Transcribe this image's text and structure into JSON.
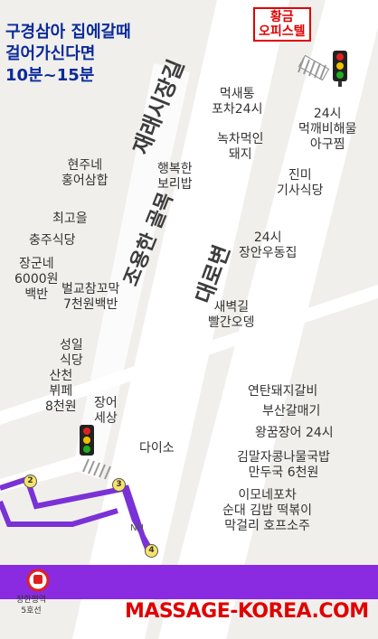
{
  "headline": {
    "line1": "구경삼아 집에갈때",
    "line2": "걸어가신다면",
    "line3": "10분~15분"
  },
  "badge": {
    "line1": "황금",
    "line2": "오피스텔"
  },
  "streets": {
    "jaeraesijang": "재래시장길",
    "joyonghan": "조용한 골목",
    "daerobeon": "대로변"
  },
  "places": [
    {
      "name": "먹새통\n포차24시"
    },
    {
      "name": "24시\n먹깨비해물\n아구찜"
    },
    {
      "name": "녹차먹인\n돼지"
    },
    {
      "name": "현주네\n홍어삼합"
    },
    {
      "name": "행복한\n보리밥"
    },
    {
      "name": "진미\n기사식당"
    },
    {
      "name": "최고을"
    },
    {
      "name": "충주식당"
    },
    {
      "name": "24시\n장안우동집"
    },
    {
      "name": "장군네\n6000원\n백반"
    },
    {
      "name": "벌교참꼬막\n7천원백반"
    },
    {
      "name": "새벽길\n빨간오뎅"
    },
    {
      "name": "성일\n식당"
    },
    {
      "name": "산천\n뷔페\n8천원"
    },
    {
      "name": "장어\n세상"
    },
    {
      "name": "연탄돼지갈비"
    },
    {
      "name": "부산갈매기"
    },
    {
      "name": "왕꿈장어 24시"
    },
    {
      "name": "다이소"
    },
    {
      "name": "김말자콩나물국밥\n만두국 6천원"
    },
    {
      "name": "이모네포차\n순대 김밥 떡볶이\n막걸리 호프소주"
    }
  ],
  "exits": [
    "2",
    "3",
    "4"
  ],
  "station": {
    "line1": "장한평역",
    "line2": "5호선"
  },
  "nh_label": "NH",
  "watermark": "MASSAGE-KOREA.COM",
  "colors": {
    "road": "#ffffff",
    "background": "#f0efec",
    "subway": "#8a2be2",
    "headline": "#0a2a9a",
    "badge": "#e00000"
  },
  "icons": [
    "traffic-light-icon",
    "crosswalk-icon",
    "subway-station-icon"
  ]
}
